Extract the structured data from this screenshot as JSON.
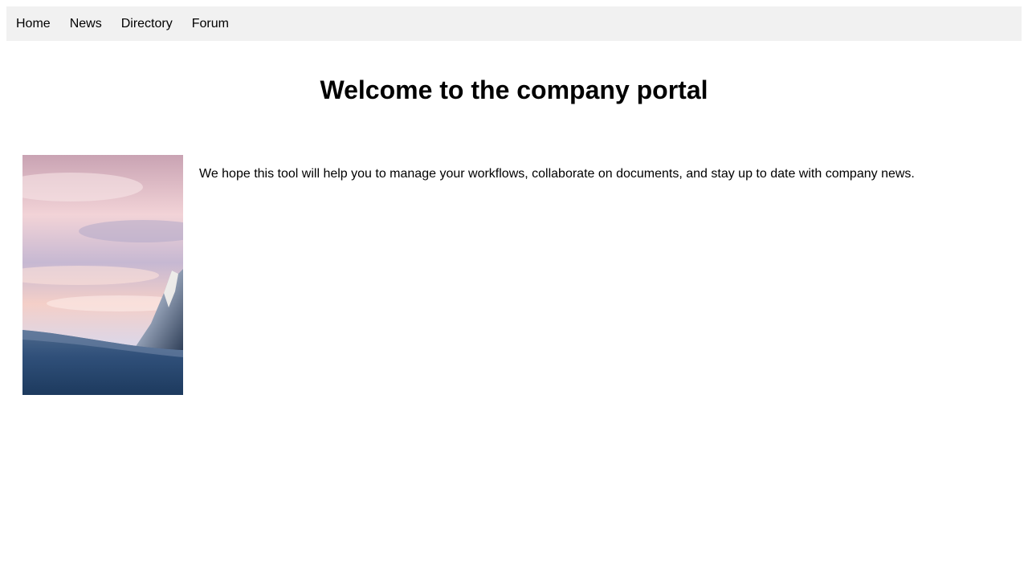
{
  "nav": {
    "items": [
      {
        "label": "Home"
      },
      {
        "label": "News"
      },
      {
        "label": "Directory"
      },
      {
        "label": "Forum"
      }
    ],
    "background": "#f1f1f1"
  },
  "main": {
    "title": "Welcome to the company portal",
    "intro": "We hope this tool will help you to manage your workflows, collaborate on documents, and stay up to date with company news.",
    "image": {
      "subject": "snowy mountain peak under a pink sunset sky"
    }
  }
}
